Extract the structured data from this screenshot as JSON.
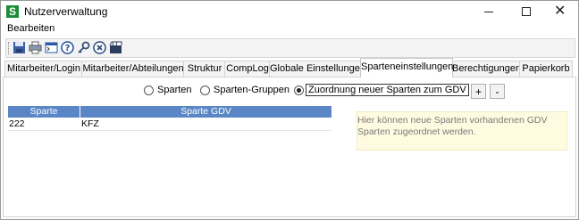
{
  "window": {
    "title": "Nutzerverwaltung",
    "app_icon_letter": "S",
    "controls": {
      "minimize": "—",
      "maximize": "☐",
      "close": "✕"
    }
  },
  "menu": {
    "items": [
      "Bearbeiten"
    ]
  },
  "toolbar": {
    "buttons": [
      "save-icon",
      "print-icon",
      "console-icon",
      "help-icon",
      "key-icon",
      "cancel-icon",
      "clapperboard-icon"
    ]
  },
  "tabs": [
    {
      "label": "Mitarbeiter/Login",
      "active": false
    },
    {
      "label": "Mitarbeiter/Abteilungen",
      "active": false
    },
    {
      "label": "Struktur",
      "active": false
    },
    {
      "label": "CompLog",
      "active": false
    },
    {
      "label": "Globale Einstellungen",
      "active": false
    },
    {
      "label": "Sparteneinstellungen",
      "active": true
    },
    {
      "label": "Berechtigungen",
      "active": false
    },
    {
      "label": "Papierkorb",
      "active": false
    }
  ],
  "options": [
    {
      "label": "Sparten",
      "checked": false
    },
    {
      "label": "Sparten-Gruppen",
      "checked": false
    },
    {
      "label": "Zuordnung neuer Sparten zum GDV",
      "checked": true
    }
  ],
  "buttons": {
    "add": "+",
    "remove": "-"
  },
  "table": {
    "headers": [
      "Sparte",
      "Sparte GDV"
    ],
    "rows": [
      [
        "222",
        "KFZ"
      ]
    ],
    "header_color": "#5b86c5"
  },
  "info": {
    "text": "Hier können neue Sparten vorhandenen GDV Sparten zugeordnet werden."
  },
  "colors": {
    "brand": "#1e8c3a",
    "info_bg": "#fffbe1"
  }
}
